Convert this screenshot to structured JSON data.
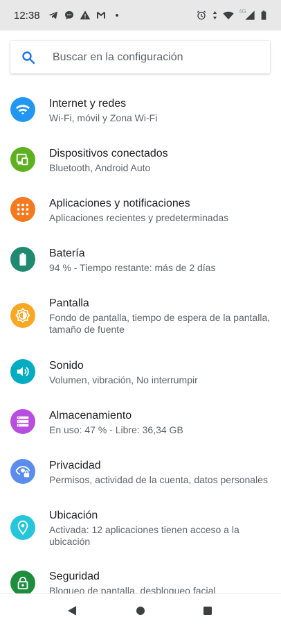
{
  "status_bar": {
    "time": "12:38",
    "network_type": "4G",
    "icons_left": [
      "telegram-icon",
      "chat-bubble-icon",
      "warning-icon",
      "gmail-icon",
      "dot-icon"
    ],
    "icons_right": [
      "alarm-icon",
      "data-arrows-icon",
      "wifi-icon",
      "cell-signal-icon",
      "battery-icon"
    ]
  },
  "search": {
    "placeholder": "Buscar en la configuración",
    "icon": "search-icon",
    "accent": "#1a73e8"
  },
  "settings": [
    {
      "title": "Internet y redes",
      "subtitle": "Wi-Fi, móvil y Zona Wi-Fi",
      "icon": "wifi-icon",
      "color": "#2196f3"
    },
    {
      "title": "Dispositivos conectados",
      "subtitle": "Bluetooth, Android Auto",
      "icon": "devices-icon",
      "color": "#5eb021"
    },
    {
      "title": "Aplicaciones y notificaciones",
      "subtitle": "Aplicaciones recientes y predeterminadas",
      "icon": "apps-grid-icon",
      "color": "#f4791f"
    },
    {
      "title": "Batería",
      "subtitle": "94 % - Tiempo restante: más de 2 días",
      "icon": "battery-icon",
      "color": "#1f8a70"
    },
    {
      "title": "Pantalla",
      "subtitle": "Fondo de pantalla, tiempo de espera de la pantalla, tamaño de fuente",
      "icon": "brightness-icon",
      "color": "#f9a825"
    },
    {
      "title": "Sonido",
      "subtitle": "Volumen, vibración, No interrumpir",
      "icon": "volume-icon",
      "color": "#00acc1"
    },
    {
      "title": "Almacenamiento",
      "subtitle": "En uso: 47 % - Libre: 36,34 GB",
      "icon": "storage-icon",
      "color": "#b84ee0"
    },
    {
      "title": "Privacidad",
      "subtitle": "Permisos, actividad de la cuenta, datos personales",
      "icon": "privacy-eye-icon",
      "color": "#5b8def"
    },
    {
      "title": "Ubicación",
      "subtitle": "Activada: 12 aplicaciones tienen acceso a la ubicación",
      "icon": "location-pin-icon",
      "color": "#26c6da"
    },
    {
      "title": "Seguridad",
      "subtitle": "Bloqueo de pantalla, desbloqueo facial",
      "icon": "lock-icon",
      "color": "#1e8e3e"
    }
  ],
  "nav_bar": {
    "buttons": [
      "back-icon",
      "home-icon",
      "recents-icon"
    ]
  }
}
